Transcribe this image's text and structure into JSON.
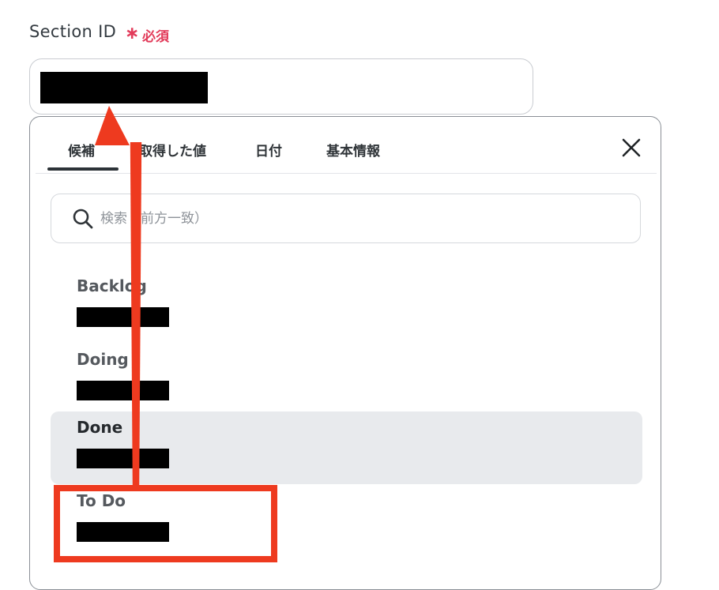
{
  "field": {
    "label": "Section ID",
    "required_mark": "∗",
    "required_text": "必須"
  },
  "dropdown": {
    "tabs": [
      {
        "label": "候補",
        "active": true
      },
      {
        "label": "取得した値",
        "active": false
      },
      {
        "label": "日付",
        "active": false
      },
      {
        "label": "基本情報",
        "active": false
      }
    ],
    "close_icon": "close-icon",
    "search": {
      "placeholder": "検索（前方一致）",
      "value": "",
      "icon": "search-icon"
    },
    "options": [
      {
        "label": "Backlog",
        "selected": false
      },
      {
        "label": "Doing",
        "selected": false
      },
      {
        "label": "Done",
        "selected": true
      },
      {
        "label": "To Do",
        "selected": false
      }
    ]
  },
  "annotation": {
    "color": "#ee3a1f",
    "highlighted_option": "To Do"
  },
  "colors": {
    "required": "#e23b5a",
    "selected_row": "#e8eaed",
    "tab_underline": "#2c3237"
  }
}
